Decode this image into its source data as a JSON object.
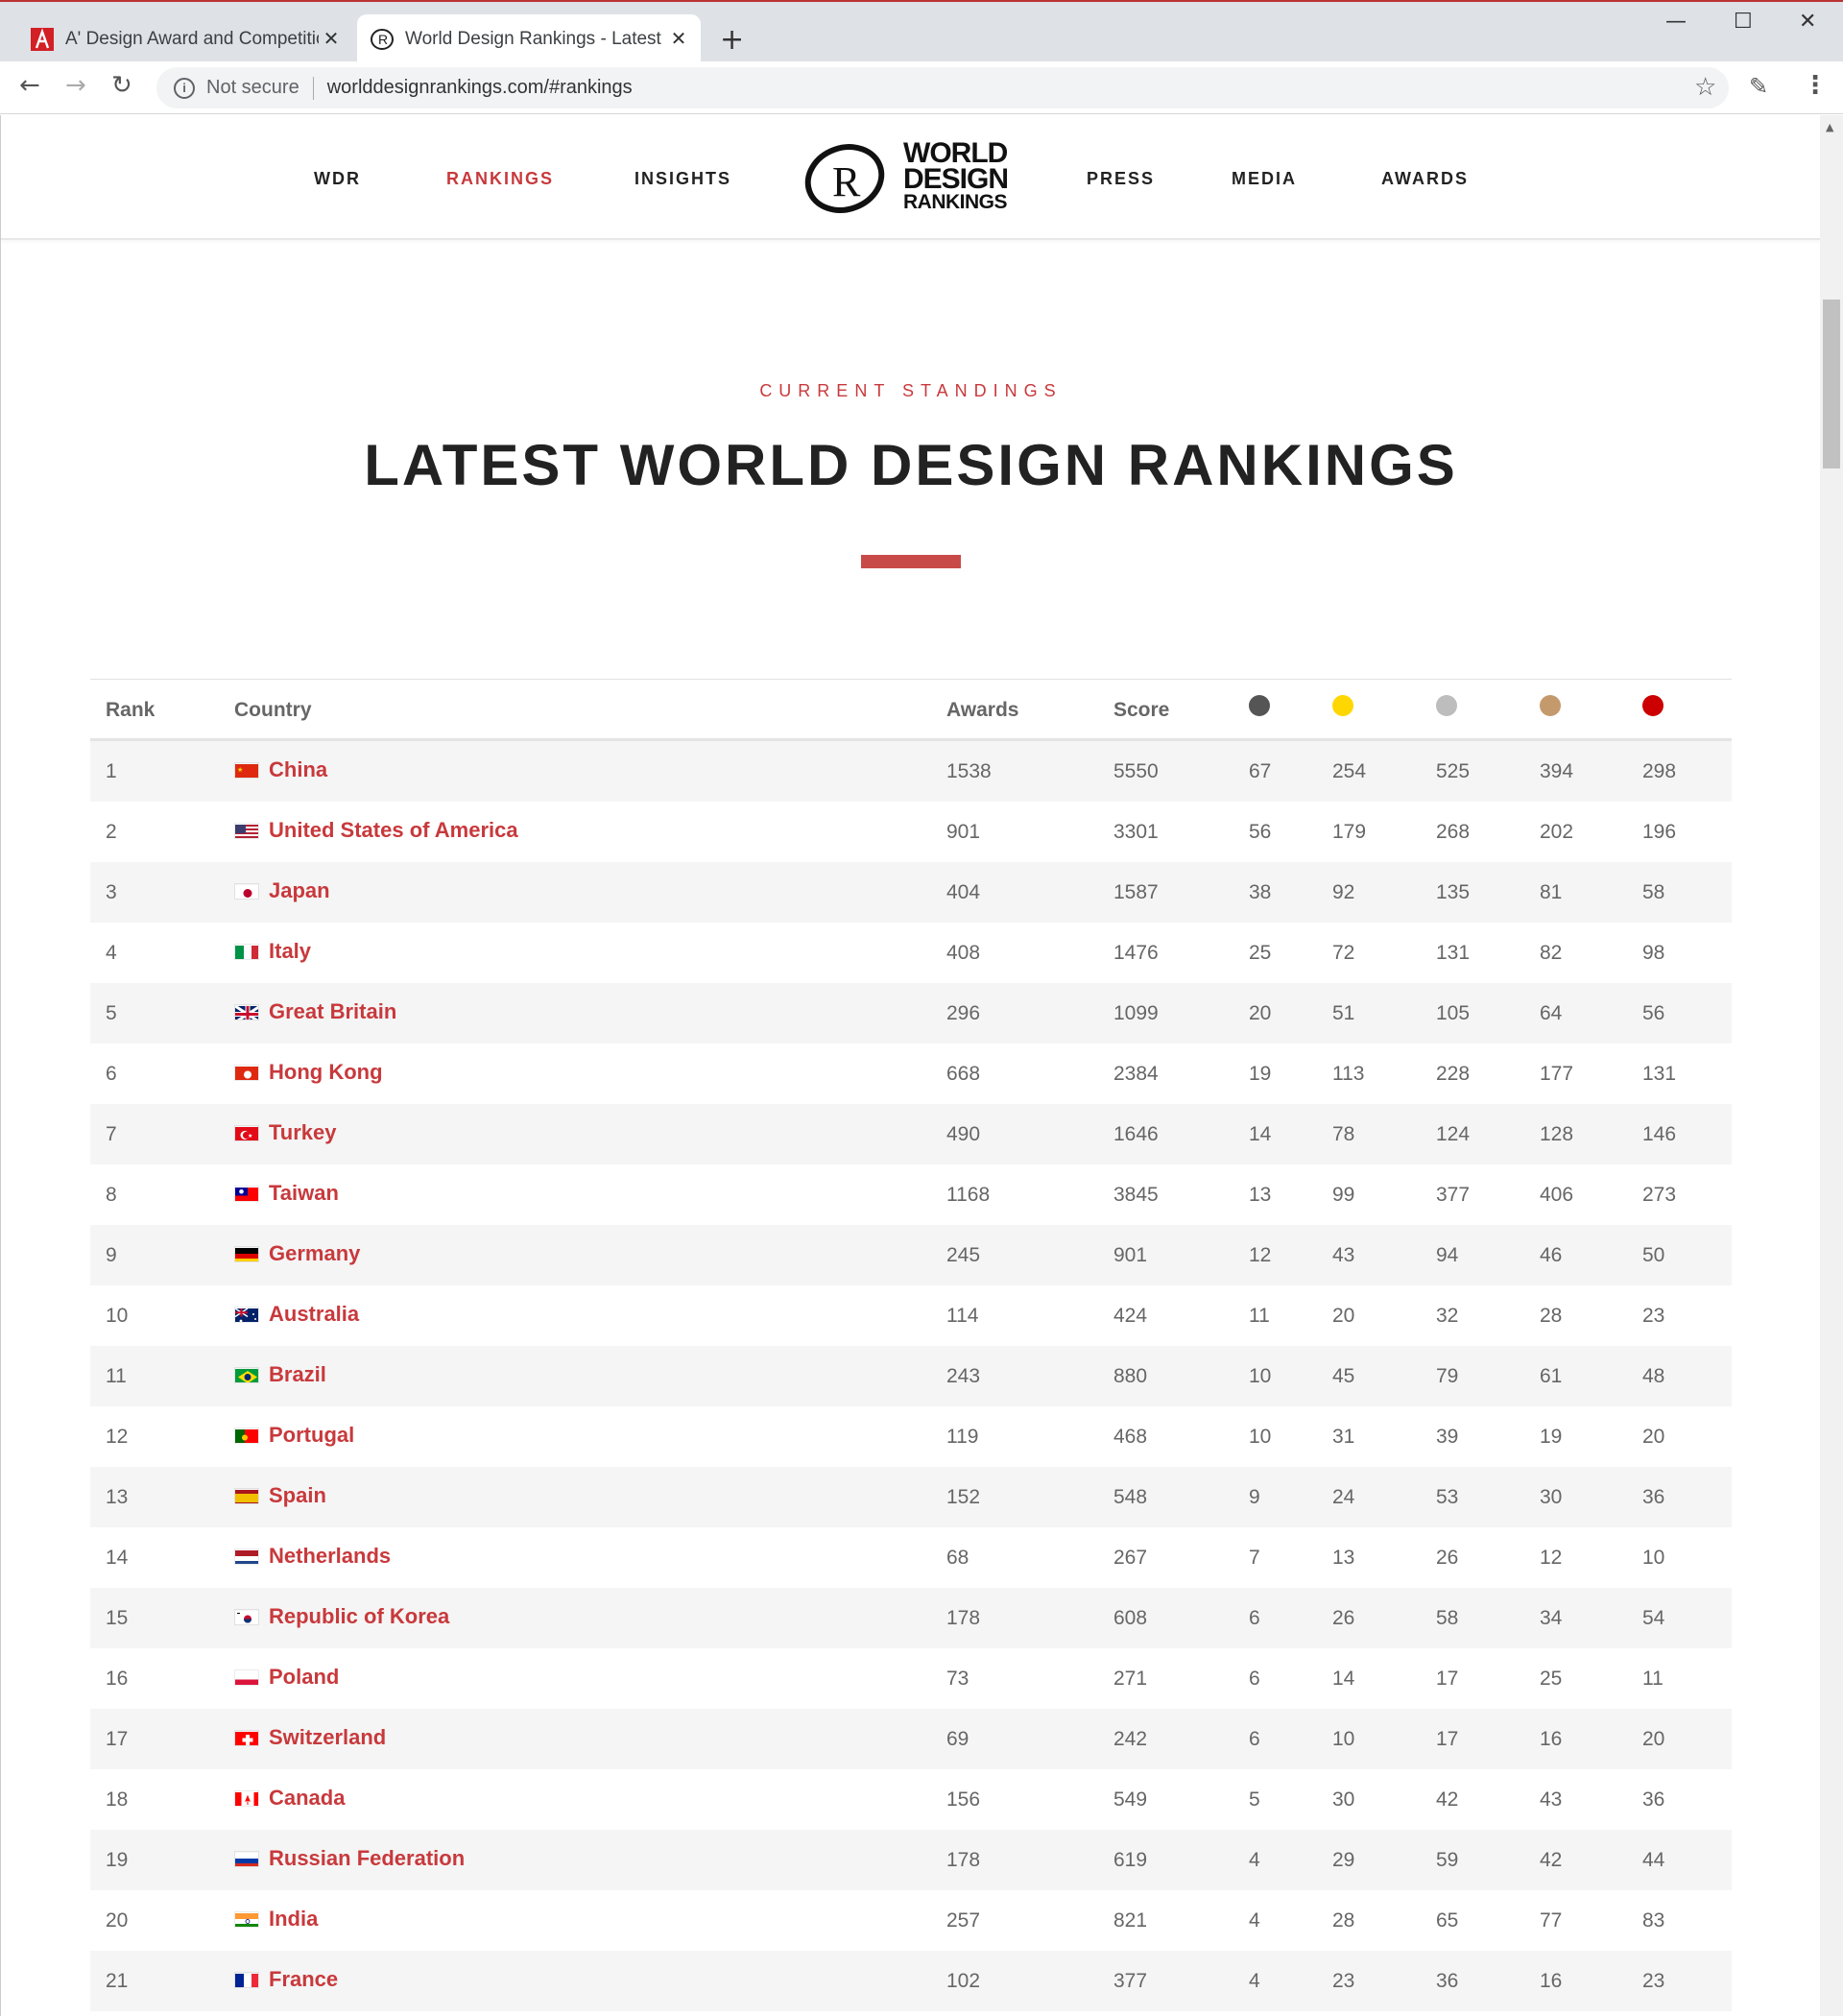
{
  "browser": {
    "tabs": [
      {
        "title": "A' Design Award and Competitio",
        "active": false,
        "favicon": "a-design-award-icon"
      },
      {
        "title": "World Design Rankings - Latest R",
        "active": true,
        "favicon": "wdr-icon"
      }
    ],
    "omnibox": {
      "security": "Not secure",
      "url": "worlddesignrankings.com/#rankings"
    }
  },
  "site": {
    "nav_left": [
      "WDR",
      "RANKINGS",
      "INSIGHTS"
    ],
    "nav_right": [
      "PRESS",
      "MEDIA",
      "AWARDS"
    ],
    "active_nav": "RANKINGS",
    "logo": {
      "line1": "WORLD",
      "line2": "DESIGN",
      "line3": "RANKINGS",
      "mark": "R"
    }
  },
  "section": {
    "eyebrow": "CURRENT STANDINGS",
    "title": "LATEST WORLD DESIGN RANKINGS"
  },
  "colors": {
    "accent": "#c8393c",
    "platinum": "#555555",
    "gold": "#ffd700",
    "silver": "#bdbdbd",
    "bronze": "#c49a6c",
    "iron": "#cc0000"
  },
  "table": {
    "headers": {
      "rank": "Rank",
      "country": "Country",
      "awards": "Awards",
      "score": "Score"
    },
    "medal_columns": [
      "platinum",
      "gold",
      "silver",
      "bronze",
      "iron"
    ],
    "rows": [
      {
        "rank": "1",
        "country": "China",
        "flag": "cn",
        "awards": "1538",
        "score": "5550",
        "m1": "67",
        "m2": "254",
        "m3": "525",
        "m4": "394",
        "m5": "298"
      },
      {
        "rank": "2",
        "country": "United States of America",
        "flag": "us",
        "awards": "901",
        "score": "3301",
        "m1": "56",
        "m2": "179",
        "m3": "268",
        "m4": "202",
        "m5": "196"
      },
      {
        "rank": "3",
        "country": "Japan",
        "flag": "jp",
        "awards": "404",
        "score": "1587",
        "m1": "38",
        "m2": "92",
        "m3": "135",
        "m4": "81",
        "m5": "58"
      },
      {
        "rank": "4",
        "country": "Italy",
        "flag": "it",
        "awards": "408",
        "score": "1476",
        "m1": "25",
        "m2": "72",
        "m3": "131",
        "m4": "82",
        "m5": "98"
      },
      {
        "rank": "5",
        "country": "Great Britain",
        "flag": "gb",
        "awards": "296",
        "score": "1099",
        "m1": "20",
        "m2": "51",
        "m3": "105",
        "m4": "64",
        "m5": "56"
      },
      {
        "rank": "6",
        "country": "Hong Kong",
        "flag": "hk",
        "awards": "668",
        "score": "2384",
        "m1": "19",
        "m2": "113",
        "m3": "228",
        "m4": "177",
        "m5": "131"
      },
      {
        "rank": "7",
        "country": "Turkey",
        "flag": "tr",
        "awards": "490",
        "score": "1646",
        "m1": "14",
        "m2": "78",
        "m3": "124",
        "m4": "128",
        "m5": "146"
      },
      {
        "rank": "8",
        "country": "Taiwan",
        "flag": "tw",
        "awards": "1168",
        "score": "3845",
        "m1": "13",
        "m2": "99",
        "m3": "377",
        "m4": "406",
        "m5": "273"
      },
      {
        "rank": "9",
        "country": "Germany",
        "flag": "de",
        "awards": "245",
        "score": "901",
        "m1": "12",
        "m2": "43",
        "m3": "94",
        "m4": "46",
        "m5": "50"
      },
      {
        "rank": "10",
        "country": "Australia",
        "flag": "au",
        "awards": "114",
        "score": "424",
        "m1": "11",
        "m2": "20",
        "m3": "32",
        "m4": "28",
        "m5": "23"
      },
      {
        "rank": "11",
        "country": "Brazil",
        "flag": "br",
        "awards": "243",
        "score": "880",
        "m1": "10",
        "m2": "45",
        "m3": "79",
        "m4": "61",
        "m5": "48"
      },
      {
        "rank": "12",
        "country": "Portugal",
        "flag": "pt",
        "awards": "119",
        "score": "468",
        "m1": "10",
        "m2": "31",
        "m3": "39",
        "m4": "19",
        "m5": "20"
      },
      {
        "rank": "13",
        "country": "Spain",
        "flag": "es",
        "awards": "152",
        "score": "548",
        "m1": "9",
        "m2": "24",
        "m3": "53",
        "m4": "30",
        "m5": "36"
      },
      {
        "rank": "14",
        "country": "Netherlands",
        "flag": "nl",
        "awards": "68",
        "score": "267",
        "m1": "7",
        "m2": "13",
        "m3": "26",
        "m4": "12",
        "m5": "10"
      },
      {
        "rank": "15",
        "country": "Republic of Korea",
        "flag": "kr",
        "awards": "178",
        "score": "608",
        "m1": "6",
        "m2": "26",
        "m3": "58",
        "m4": "34",
        "m5": "54"
      },
      {
        "rank": "16",
        "country": "Poland",
        "flag": "pl",
        "awards": "73",
        "score": "271",
        "m1": "6",
        "m2": "14",
        "m3": "17",
        "m4": "25",
        "m5": "11"
      },
      {
        "rank": "17",
        "country": "Switzerland",
        "flag": "ch",
        "awards": "69",
        "score": "242",
        "m1": "6",
        "m2": "10",
        "m3": "17",
        "m4": "16",
        "m5": "20"
      },
      {
        "rank": "18",
        "country": "Canada",
        "flag": "ca",
        "awards": "156",
        "score": "549",
        "m1": "5",
        "m2": "30",
        "m3": "42",
        "m4": "43",
        "m5": "36"
      },
      {
        "rank": "19",
        "country": "Russian Federation",
        "flag": "ru",
        "awards": "178",
        "score": "619",
        "m1": "4",
        "m2": "29",
        "m3": "59",
        "m4": "42",
        "m5": "44"
      },
      {
        "rank": "20",
        "country": "India",
        "flag": "in",
        "awards": "257",
        "score": "821",
        "m1": "4",
        "m2": "28",
        "m3": "65",
        "m4": "77",
        "m5": "83"
      },
      {
        "rank": "21",
        "country": "France",
        "flag": "fr",
        "awards": "102",
        "score": "377",
        "m1": "4",
        "m2": "23",
        "m3": "36",
        "m4": "16",
        "m5": "23"
      }
    ]
  }
}
